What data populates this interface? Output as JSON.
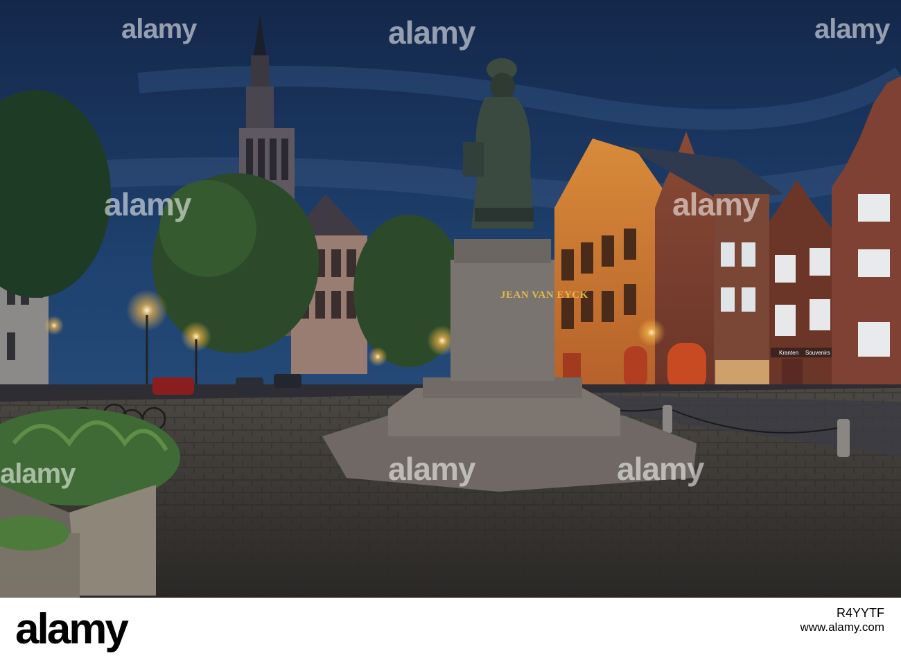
{
  "photo": {
    "statue_inscription": "JEAN VAN EYCK",
    "shop_signs": [
      "Kranten",
      "Souvenirs"
    ]
  },
  "watermark": {
    "text": "alamy"
  },
  "footer": {
    "brand": "alamy",
    "image_id": "R4YYTF",
    "site": "www.alamy.com"
  },
  "colors": {
    "sky": "#1d3a66",
    "lamp_glow": "#f5b84a",
    "brand_text": "#000000"
  }
}
